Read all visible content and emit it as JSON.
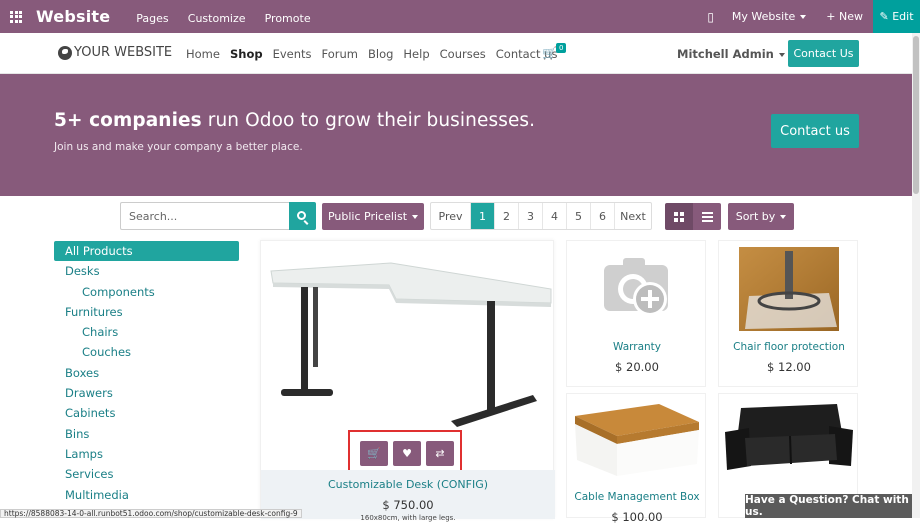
{
  "adminbar": {
    "brand": "Website",
    "menu": [
      "Pages",
      "Customize",
      "Promote"
    ],
    "site": "My Website",
    "new_label": "+ New",
    "edit_label": "Edit"
  },
  "navbar": {
    "logo": "YOUR WEBSITE",
    "links": [
      "Home",
      "Shop",
      "Events",
      "Forum",
      "Blog",
      "Help",
      "Courses",
      "Contact us"
    ],
    "cart_count": "0",
    "user": "Mitchell Admin",
    "contact_label": "Contact Us"
  },
  "hero": {
    "title_bold": "5+ companies",
    "title_rest": " run Odoo to grow their businesses.",
    "subtitle": "Join us and make your company a better place.",
    "cta": "Contact us"
  },
  "toolbar": {
    "search_placeholder": "Search...",
    "pricelist": "Public Pricelist",
    "pager": {
      "prev": "Prev",
      "pages": [
        "1",
        "2",
        "3",
        "4",
        "5",
        "6"
      ],
      "next": "Next",
      "active": "1"
    },
    "sort": "Sort by"
  },
  "categories": [
    {
      "label": "All Products",
      "sub": false,
      "active": true
    },
    {
      "label": "Desks",
      "sub": false
    },
    {
      "label": "Components",
      "sub": true
    },
    {
      "label": "Furnitures",
      "sub": false
    },
    {
      "label": "Chairs",
      "sub": true
    },
    {
      "label": "Couches",
      "sub": true
    },
    {
      "label": "Boxes",
      "sub": false
    },
    {
      "label": "Drawers",
      "sub": false
    },
    {
      "label": "Cabinets",
      "sub": false
    },
    {
      "label": "Bins",
      "sub": false
    },
    {
      "label": "Lamps",
      "sub": false
    },
    {
      "label": "Services",
      "sub": false
    },
    {
      "label": "Multimedia",
      "sub": false
    }
  ],
  "products": {
    "featured": {
      "name": "Customizable Desk (CONFIG)",
      "price": "$ 750.00",
      "desc": "160x80cm, with large legs."
    },
    "warranty": {
      "name": "Warranty",
      "price": "$ 20.00"
    },
    "chair_floor": {
      "name": "Chair floor protection",
      "price": "$ 12.00"
    },
    "cable_box": {
      "name": "Cable Management Box",
      "price": "$ 100.00"
    }
  },
  "status_url": "https://8588083-14-0-all.runbot51.odoo.com/shop/customizable-desk-config-9",
  "chat": "Have a Question? Chat with us."
}
